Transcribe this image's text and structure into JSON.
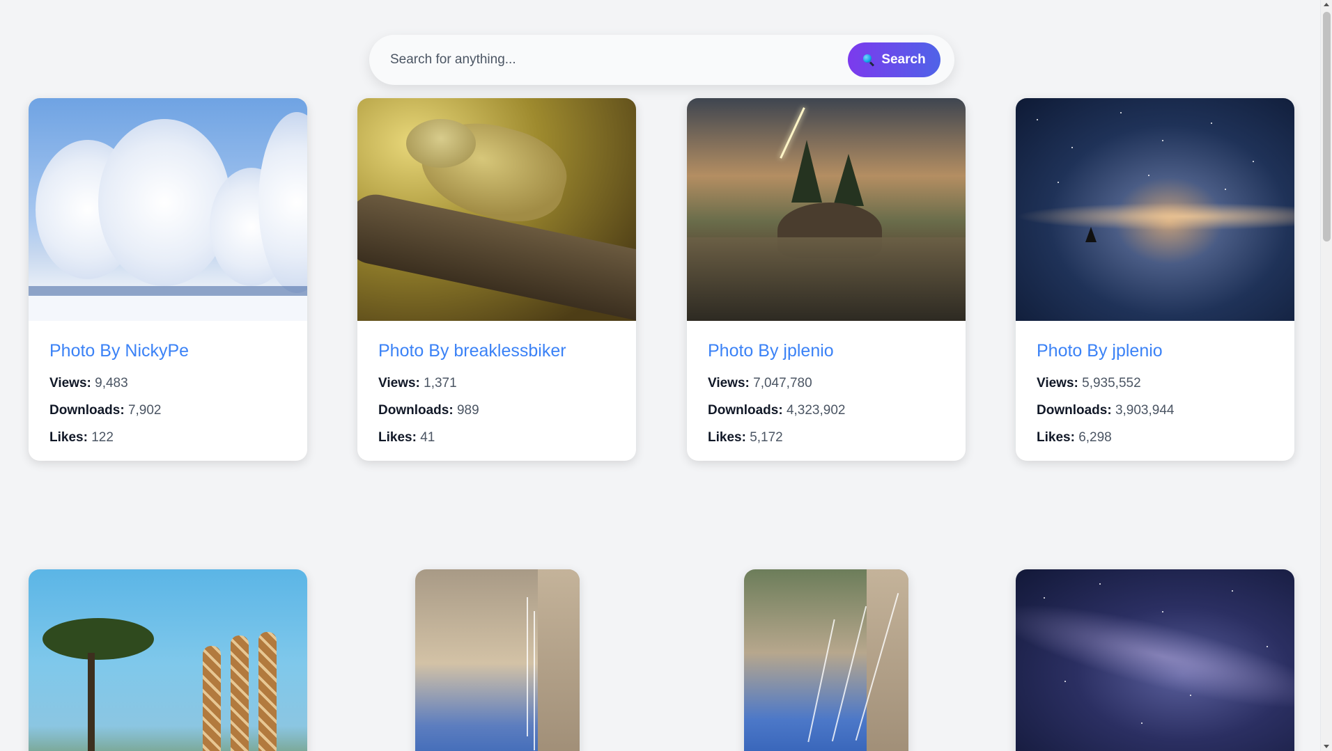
{
  "search": {
    "placeholder": "Search for anything...",
    "button_label": "Search",
    "button_icon": "magnifier-icon"
  },
  "labels": {
    "title_prefix": "Photo By",
    "views": "Views:",
    "downloads": "Downloads:",
    "likes": "Likes:"
  },
  "cards": [
    {
      "author": "Photo By NickyPe",
      "views": "9,483",
      "downloads": "7,902",
      "likes": "122"
    },
    {
      "author": "Photo By breaklessbiker",
      "views": "1,371",
      "downloads": "989",
      "likes": "41"
    },
    {
      "author": "Photo By jplenio",
      "views": "7,047,780",
      "downloads": "4,323,902",
      "likes": "5,172"
    },
    {
      "author": "Photo By jplenio",
      "views": "5,935,552",
      "downloads": "3,903,944",
      "likes": "6,298"
    }
  ],
  "colors": {
    "accent_title": "#3b82f6",
    "button_gradient_start": "#7c3aed",
    "button_gradient_end": "#4f63e8",
    "background": "#f3f4f6"
  }
}
